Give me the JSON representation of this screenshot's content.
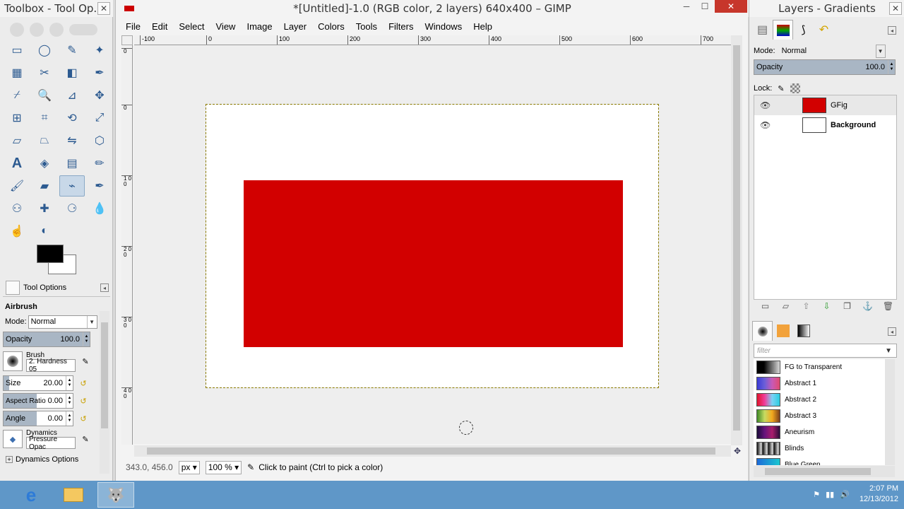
{
  "toolbox": {
    "title": "Toolbox - Tool Op...",
    "tools": [
      {
        "name": "rect-select-icon",
        "active": false
      },
      {
        "name": "ellipse-select-icon",
        "active": false
      },
      {
        "name": "free-select-icon",
        "active": false
      },
      {
        "name": "fuzzy-select-icon",
        "active": false
      },
      {
        "name": "color-select-icon",
        "active": false
      },
      {
        "name": "scissors-icon",
        "active": false
      },
      {
        "name": "foreground-select-icon",
        "active": false
      },
      {
        "name": "paths-icon",
        "active": false
      },
      {
        "name": "color-picker-icon",
        "active": false
      },
      {
        "name": "zoom-icon",
        "active": false
      },
      {
        "name": "measure-icon",
        "active": false
      },
      {
        "name": "move-icon",
        "active": false
      },
      {
        "name": "align-icon",
        "active": false
      },
      {
        "name": "crop-icon",
        "active": false
      },
      {
        "name": "rotate-icon",
        "active": false
      },
      {
        "name": "scale-icon",
        "active": false
      },
      {
        "name": "shear-icon",
        "active": false
      },
      {
        "name": "perspective-icon",
        "active": false
      },
      {
        "name": "flip-icon",
        "active": false
      },
      {
        "name": "cage-transform-icon",
        "active": false
      },
      {
        "name": "text-icon",
        "active": false
      },
      {
        "name": "bucket-fill-icon",
        "active": false
      },
      {
        "name": "blend-icon",
        "active": false
      },
      {
        "name": "pencil-icon",
        "active": false
      },
      {
        "name": "paintbrush-icon",
        "active": false
      },
      {
        "name": "eraser-icon",
        "active": false
      },
      {
        "name": "airbrush-icon",
        "active": true
      },
      {
        "name": "ink-icon",
        "active": false
      },
      {
        "name": "clone-icon",
        "active": false
      },
      {
        "name": "heal-icon",
        "active": false
      },
      {
        "name": "perspective-clone-icon",
        "active": false
      },
      {
        "name": "blur-sharpen-icon",
        "active": false
      },
      {
        "name": "smudge-icon",
        "active": false
      },
      {
        "name": "dodge-burn-icon",
        "active": false
      }
    ],
    "tool_options_tab": "Tool Options",
    "tool_title": "Airbrush",
    "mode_label": "Mode:",
    "mode_value": "Normal",
    "opacity_label": "Opacity",
    "opacity_value": "100.0",
    "brush_label": "Brush",
    "brush_value": "2. Hardness 05",
    "size_label": "Size",
    "size_value": "20.00",
    "aspect_label": "Aspect Ratio",
    "aspect_value": "0.00",
    "angle_label": "Angle",
    "angle_value": "0.00",
    "dynamics_label": "Dynamics",
    "dynamics_value": "Pressure Opac",
    "dynamics_options": "Dynamics Options"
  },
  "image_window": {
    "title": "*[Untitled]-1.0 (RGB color, 2 layers) 640x400 – GIMP",
    "menu": [
      "File",
      "Edit",
      "Select",
      "View",
      "Image",
      "Layer",
      "Colors",
      "Tools",
      "Filters",
      "Windows",
      "Help"
    ],
    "ruler_h": [
      "-100",
      "0",
      "100",
      "200",
      "300",
      "400",
      "500",
      "600",
      "700"
    ],
    "ruler_v": [
      "0",
      "0",
      "1 0 0",
      "2 0 0",
      "3 0 0",
      "4 0 0"
    ],
    "status": {
      "coords": "343.0, 456.0",
      "unit": "px",
      "zoom": "100 %",
      "message": "Click to paint (Ctrl to pick a color)"
    },
    "rect_color": "#d20000"
  },
  "dock": {
    "title": "Layers - Gradients",
    "mode_label": "Mode:",
    "mode_value": "Normal",
    "opacity_label": "Opacity",
    "opacity_value": "100.0",
    "lock_label": "Lock:",
    "layers": [
      {
        "name": "GFig",
        "thumb": "#d20000",
        "selected": true
      },
      {
        "name": "Background",
        "thumb": "#ffffff",
        "selected": false
      }
    ],
    "gradient_filter_placeholder": "filter",
    "gradients": [
      {
        "name": "FG to Transparent",
        "css": "linear-gradient(90deg,#000 0%,#000 30%,rgba(0,0,0,0.15) 100%)"
      },
      {
        "name": "Abstract 1",
        "css": "linear-gradient(90deg,#3b3bd6,#6b5fd8,#c85ab6,#e04a6f)"
      },
      {
        "name": "Abstract 2",
        "css": "linear-gradient(90deg,#e0142b,#f13c9a,#7bd2f5,#2acde0)"
      },
      {
        "name": "Abstract 3",
        "css": "linear-gradient(90deg,#3f8a26,#c6dc63,#f3a81d,#7a3f1c)"
      },
      {
        "name": "Aneurism",
        "css": "linear-gradient(90deg,#1c0c3a,#66137c,#a91c6b,#2a0d3a)"
      },
      {
        "name": "Blinds",
        "css": "repeating-linear-gradient(90deg,#111 0px,#ddd 6px,#111 8px)"
      },
      {
        "name": "Blue Green",
        "css": "linear-gradient(90deg,#1d6ad8,#19c7d0)"
      }
    ]
  },
  "taskbar": {
    "clock_time": "2:07 PM",
    "clock_date": "12/13/2012"
  }
}
